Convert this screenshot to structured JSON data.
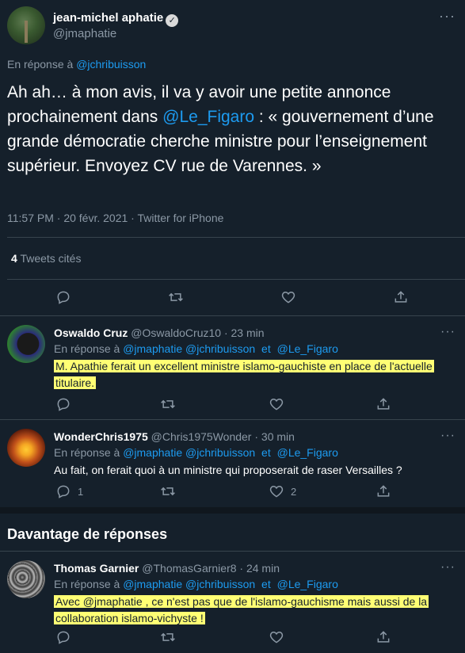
{
  "author": {
    "name": "jean-michel aphatie",
    "handle": "@jmaphatie",
    "verified_glyph": "✓",
    "more_glyph": "···"
  },
  "reply_context": {
    "prefix": "En réponse à",
    "mention": "@jchribuisson"
  },
  "tweet": {
    "text_part1": "Ah ah… à mon avis, il va y avoir une petite annonce prochainement dans ",
    "mention": "@Le_Figaro",
    "text_part2": " : « gouvernement d’une grande démocratie cherche ministre pour l’enseignement supérieur. Envoyez CV rue de Varennes. »",
    "timestamp": "11:57 PM · 20 févr. 2021 · Twitter for iPhone"
  },
  "quotes": {
    "count": "4",
    "label": "Tweets cités"
  },
  "replies": [
    {
      "name": "Oswaldo Cruz",
      "handle": "@OswaldoCruz10",
      "time": "· 23 min",
      "reply_prefix": "En réponse à",
      "mention1": "@jmaphatie",
      "mention2": "@jchribuisson",
      "and_word": "et",
      "mention3": "@Le_Figaro",
      "text": "M. Apathie ferait un excellent ministre islamo-gauchiste en place de l'actuelle titulaire.",
      "reply_count": "",
      "like_count": ""
    },
    {
      "name": "WonderChris1975",
      "handle": "@Chris1975Wonder",
      "time": "· 30 min",
      "reply_prefix": "En réponse à",
      "mention1": "@jmaphatie",
      "mention2": "@jchribuisson",
      "and_word": "et",
      "mention3": "@Le_Figaro",
      "text": "Au fait, on ferait quoi à un ministre qui proposerait de raser Versailles ?",
      "reply_count": "1",
      "like_count": "2"
    },
    {
      "name": "Thomas Garnier",
      "handle": "@ThomasGarnier8",
      "time": "· 24 min",
      "reply_prefix": "En réponse à",
      "mention1": "@jmaphatie",
      "mention2": "@jchribuisson",
      "and_word": "et",
      "mention3": "@Le_Figaro",
      "text": "Avec @jmaphatie , ce n'est pas que de l'islamo-gauchisme mais aussi de la collaboration islamo-vichyste !",
      "reply_count": "",
      "like_count": ""
    }
  ],
  "more_replies_title": "Davantage de réponses",
  "colors": {
    "background": "#15202b",
    "accent": "#1d9bf0",
    "muted": "#8b98a5",
    "highlight": "#ffff74"
  }
}
